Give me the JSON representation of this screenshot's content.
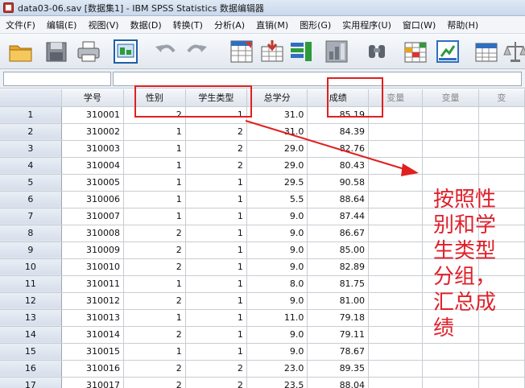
{
  "window": {
    "title": "data03-06.sav [数据集1] - IBM SPSS Statistics 数据编辑器"
  },
  "menu": [
    "文件(F)",
    "编辑(E)",
    "视图(V)",
    "数据(D)",
    "转换(T)",
    "分析(A)",
    "直销(M)",
    "图形(G)",
    "实用程序(U)",
    "窗口(W)",
    "帮助(H)"
  ],
  "toolbar": {
    "icons": [
      "open-folder-icon",
      "save-icon",
      "print-icon",
      "dialog-recall-icon",
      "undo-icon",
      "redo-icon",
      "goto-case-icon",
      "goto-variable-icon",
      "variables-icon",
      "chart-icon",
      "find-icon",
      "insert-cases-icon",
      "split-file-icon",
      "value-labels-icon",
      "weight-cases-icon"
    ]
  },
  "grid": {
    "columns": [
      "学号",
      "性别",
      "学生类型",
      "总学分",
      "成绩",
      "变量",
      "变量",
      "变"
    ],
    "rows": [
      {
        "n": "1",
        "cells": [
          "310001",
          "2",
          "1",
          "31.0",
          "85.19"
        ]
      },
      {
        "n": "2",
        "cells": [
          "310002",
          "1",
          "2",
          "31.0",
          "84.39"
        ]
      },
      {
        "n": "3",
        "cells": [
          "310003",
          "1",
          "2",
          "29.0",
          "82.76"
        ]
      },
      {
        "n": "4",
        "cells": [
          "310004",
          "1",
          "2",
          "29.0",
          "80.43"
        ]
      },
      {
        "n": "5",
        "cells": [
          "310005",
          "1",
          "1",
          "29.5",
          "90.58"
        ]
      },
      {
        "n": "6",
        "cells": [
          "310006",
          "1",
          "1",
          "5.5",
          "88.64"
        ]
      },
      {
        "n": "7",
        "cells": [
          "310007",
          "1",
          "1",
          "9.0",
          "87.44"
        ]
      },
      {
        "n": "8",
        "cells": [
          "310008",
          "2",
          "1",
          "9.0",
          "86.67"
        ]
      },
      {
        "n": "9",
        "cells": [
          "310009",
          "2",
          "1",
          "9.0",
          "85.00"
        ]
      },
      {
        "n": "10",
        "cells": [
          "310010",
          "2",
          "1",
          "9.0",
          "82.89"
        ]
      },
      {
        "n": "11",
        "cells": [
          "310011",
          "1",
          "1",
          "8.0",
          "81.75"
        ]
      },
      {
        "n": "12",
        "cells": [
          "310012",
          "2",
          "1",
          "9.0",
          "81.00"
        ]
      },
      {
        "n": "13",
        "cells": [
          "310013",
          "1",
          "1",
          "11.0",
          "79.18"
        ]
      },
      {
        "n": "14",
        "cells": [
          "310014",
          "2",
          "1",
          "9.0",
          "79.11"
        ]
      },
      {
        "n": "15",
        "cells": [
          "310015",
          "1",
          "1",
          "9.0",
          "78.67"
        ]
      },
      {
        "n": "16",
        "cells": [
          "310016",
          "2",
          "2",
          "23.0",
          "89.35"
        ]
      },
      {
        "n": "17",
        "cells": [
          "310017",
          "2",
          "2",
          "23.5",
          "88.04"
        ]
      }
    ]
  },
  "annotation": {
    "text": "按照性别和学生类型分组，汇总成绩",
    "color": "#e02020"
  }
}
